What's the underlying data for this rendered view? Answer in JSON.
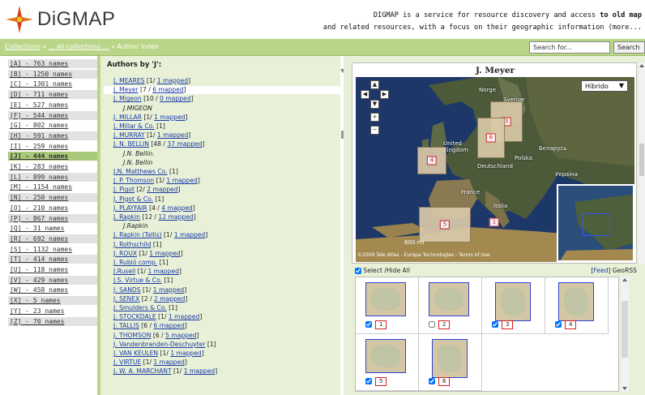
{
  "header": {
    "logo_text": "DiGMAP",
    "tagline_line1_prefix": "DIGMAP is a service for resource discovery and access ",
    "tagline_line1_bold": "to old map",
    "tagline_line2": "and related resources, with a focus on their geographic information (more..."
  },
  "nav": {
    "crumb_collections": "Collections",
    "crumb_sep1": " » ",
    "crumb_all": "... all collections ...",
    "crumb_sep2": " » ",
    "crumb_current": "Author Index",
    "search_placeholder": "Search for...",
    "search_button": "Search"
  },
  "letters": [
    {
      "label": "[A] - 763 names",
      "state": "shade"
    },
    {
      "label": "[B] - 1250 names",
      "state": "shade"
    },
    {
      "label": "[C] - 1301 names",
      "state": "normal"
    },
    {
      "label": "[D] - 711 names",
      "state": "shade"
    },
    {
      "label": "[E] - 527 names",
      "state": "normal"
    },
    {
      "label": "[F] - 544 names",
      "state": "shade"
    },
    {
      "label": "[G] - 802 names",
      "state": "normal"
    },
    {
      "label": "[H] - 591 names",
      "state": "shade"
    },
    {
      "label": "[I] - 259 names",
      "state": "normal"
    },
    {
      "label": "[J] - 444 names",
      "state": "active"
    },
    {
      "label": "[K] - 283 names",
      "state": "normal"
    },
    {
      "label": "[L] - 899 names",
      "state": "shade"
    },
    {
      "label": "[M] - 1154 names",
      "state": "normal"
    },
    {
      "label": "[N] - 250 names",
      "state": "shade"
    },
    {
      "label": "[O] - 210 names",
      "state": "normal"
    },
    {
      "label": "[P] - 867 names",
      "state": "shade"
    },
    {
      "label": "[Q] - 31 names",
      "state": "normal"
    },
    {
      "label": "[R] - 692 names",
      "state": "shade"
    },
    {
      "label": "[S] - 1132 names",
      "state": "normal"
    },
    {
      "label": "[T] - 414 names",
      "state": "shade"
    },
    {
      "label": "[U] - 118 names",
      "state": "normal"
    },
    {
      "label": "[V] - 429 names",
      "state": "shade"
    },
    {
      "label": "[W] - 458 names",
      "state": "normal"
    },
    {
      "label": "[X] - 5 names",
      "state": "shade"
    },
    {
      "label": "[Y] - 23 names",
      "state": "normal"
    },
    {
      "label": "[Z] - 70 names",
      "state": "shade"
    }
  ],
  "authors": {
    "title": "Authors by 'J':",
    "entries": [
      {
        "name": "J. MEARES",
        "count": " [1/ ",
        "mapped": "1 mapped",
        "tail": "]",
        "kind": "link"
      },
      {
        "name": "J. Meyer",
        "count": " [7 / ",
        "mapped": "6 mapped",
        "tail": "]",
        "kind": "link-hl"
      },
      {
        "name": "J. Migeon",
        "count": " [10 / ",
        "mapped": "0 mapped",
        "tail": "]",
        "kind": "link"
      },
      {
        "name": "J.MIGEON",
        "count": "",
        "mapped": "",
        "tail": "",
        "kind": "italic"
      },
      {
        "name": "J. MILLAR",
        "count": " [1/ ",
        "mapped": "1 mapped",
        "tail": "]",
        "kind": "link"
      },
      {
        "name": "J. Millar & Co.",
        "count": " [1]",
        "mapped": "",
        "tail": "",
        "kind": "link"
      },
      {
        "name": "J. MURRAY",
        "count": " [1/ ",
        "mapped": "1 mapped",
        "tail": "]",
        "kind": "link"
      },
      {
        "name": "J. N. BELLIN",
        "count": " [48 / ",
        "mapped": "37 mapped",
        "tail": "]",
        "kind": "link"
      },
      {
        "name": "J.N. Bellin.",
        "count": "",
        "mapped": "",
        "tail": "",
        "kind": "italic"
      },
      {
        "name": "J.N. Bellin",
        "count": "",
        "mapped": "",
        "tail": "",
        "kind": "italic"
      },
      {
        "name": "J.N. Matthews Co.",
        "count": " [1]",
        "mapped": "",
        "tail": "",
        "kind": "link"
      },
      {
        "name": "J. P. Thomson",
        "count": " [1/ ",
        "mapped": "1 mapped",
        "tail": "]",
        "kind": "link"
      },
      {
        "name": "J. Pigot",
        "count": " [2/ ",
        "mapped": "2 mapped",
        "tail": "]",
        "kind": "link"
      },
      {
        "name": "J. Pigot & Co.",
        "count": " [1]",
        "mapped": "",
        "tail": "",
        "kind": "link"
      },
      {
        "name": "J. PLAYFAIR",
        "count": " [4 / ",
        "mapped": "4 mapped",
        "tail": "]",
        "kind": "link"
      },
      {
        "name": "J. Rapkin",
        "count": " [12 / ",
        "mapped": "12 mapped",
        "tail": "]",
        "kind": "link"
      },
      {
        "name": "J.Rapkin",
        "count": "",
        "mapped": "",
        "tail": "",
        "kind": "italic"
      },
      {
        "name": "J. Rapkin (Tallis)",
        "count": " [1/ ",
        "mapped": "1 mapped",
        "tail": "]",
        "kind": "link"
      },
      {
        "name": "J. Rothschild",
        "count": " [1]",
        "mapped": "",
        "tail": "",
        "kind": "link"
      },
      {
        "name": "J. ROUX",
        "count": " [1/ ",
        "mapped": "1 mapped",
        "tail": "]",
        "kind": "link"
      },
      {
        "name": "J. Rubió comp.",
        "count": " [1]",
        "mapped": "",
        "tail": "",
        "kind": "link"
      },
      {
        "name": "J.Rusell",
        "count": " [1/ ",
        "mapped": "1 mapped",
        "tail": "]",
        "kind": "link"
      },
      {
        "name": "J.S. Virtue & Co.",
        "count": " [1]",
        "mapped": "",
        "tail": "",
        "kind": "link"
      },
      {
        "name": "J. SANDS",
        "count": " [1/ ",
        "mapped": "1 mapped",
        "tail": "]",
        "kind": "link"
      },
      {
        "name": "J. SENEX",
        "count": " [2 / ",
        "mapped": "2 mapped",
        "tail": "]",
        "kind": "link"
      },
      {
        "name": "J. Smulders & Co.",
        "count": " [1]",
        "mapped": "",
        "tail": "",
        "kind": "link"
      },
      {
        "name": "J. STOCKDALE",
        "count": " [1/ ",
        "mapped": "1 mapped",
        "tail": "]",
        "kind": "link"
      },
      {
        "name": "J. TALLIS",
        "count": " [6 / ",
        "mapped": "6 mapped",
        "tail": "]",
        "kind": "link"
      },
      {
        "name": "J. THOMSON",
        "count": " [6 / ",
        "mapped": "5 mapped",
        "tail": "]",
        "kind": "link"
      },
      {
        "name": "J. Vandenbranden-Deschuyter",
        "count": " [1]",
        "mapped": "",
        "tail": "",
        "kind": "link"
      },
      {
        "name": "J. VAN KEULEN",
        "count": " [1/ ",
        "mapped": "1 mapped",
        "tail": "]",
        "kind": "link"
      },
      {
        "name": "J. VIRTUE",
        "count": " [1/ ",
        "mapped": "1 mapped",
        "tail": "]",
        "kind": "link"
      },
      {
        "name": "J. W. A. MARCHANT",
        "count": " [1/ ",
        "mapped": "1 mapped",
        "tail": "]",
        "kind": "link"
      }
    ]
  },
  "map": {
    "title": "J. Meyer",
    "type_select": "Híbrido",
    "labels": [
      "United Kingdom",
      "Deutschland",
      "France",
      "Italia",
      "Polska",
      "Беларусь",
      "Україна",
      "Norge",
      "Sverige"
    ],
    "scale_text": "600 mi",
    "attribution": "©2009 Tele Atlas - Europa Technologies - Terms of Use",
    "markers": [
      "1",
      "2",
      "3",
      "4",
      "5",
      "6"
    ]
  },
  "gallery": {
    "select_all": "Select /Hide All",
    "feed_link": "Feed",
    "feed_text": " GeoRSS",
    "items": [
      {
        "num": "1",
        "checked": true
      },
      {
        "num": "2",
        "checked": false
      },
      {
        "num": "3",
        "checked": true
      },
      {
        "num": "4",
        "checked": true
      },
      {
        "num": "5",
        "checked": true
      },
      {
        "num": "6",
        "checked": true
      }
    ]
  },
  "colors": {
    "nav_green": "#b9d688",
    "panel_green": "#e8f1d8",
    "link_blue": "#1a3aa6",
    "marker_red": "#d62020"
  }
}
